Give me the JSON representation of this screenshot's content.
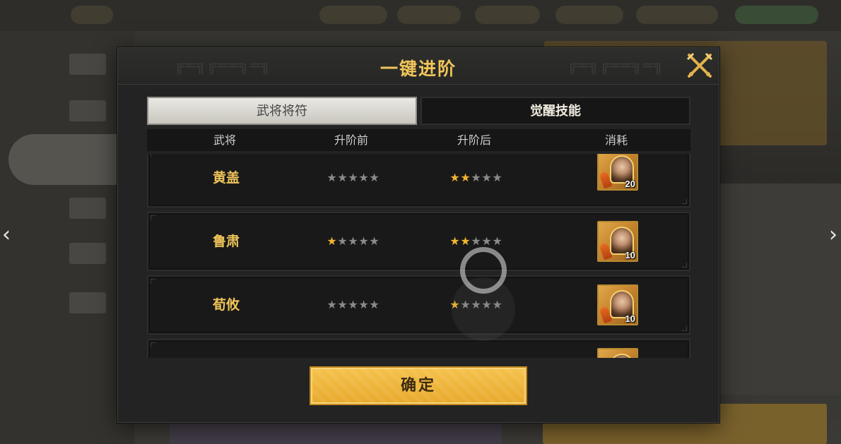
{
  "dialog": {
    "title": "一键进阶",
    "close_icon": "close-swords-icon"
  },
  "tabs": [
    {
      "label": "武将将符",
      "active": true
    },
    {
      "label": "觉醒技能",
      "active": false
    }
  ],
  "columns": [
    "武将",
    "升阶前",
    "升阶后",
    "消耗"
  ],
  "rows": [
    {
      "general": "黄盖",
      "stars_before": 0,
      "stars_after": 2,
      "max_stars": 5,
      "cost_count": "20"
    },
    {
      "general": "鲁肃",
      "stars_before": 1,
      "stars_after": 2,
      "max_stars": 5,
      "cost_count": "10"
    },
    {
      "general": "荀攸",
      "stars_before": 0,
      "stars_after": 1,
      "max_stars": 5,
      "cost_count": "10"
    },
    {
      "general": "",
      "stars_before": null,
      "stars_after": null,
      "max_stars": 5,
      "cost_count": ""
    }
  ],
  "confirm_label": "确定",
  "navigation": {
    "prev_icon": "chevron-left-icon",
    "next_icon": "chevron-right-icon"
  },
  "colors": {
    "title_gold": "#f0c55a",
    "star_on": "#f2b430",
    "star_off": "#8a8a88",
    "confirm_button": "#eeb43a"
  }
}
